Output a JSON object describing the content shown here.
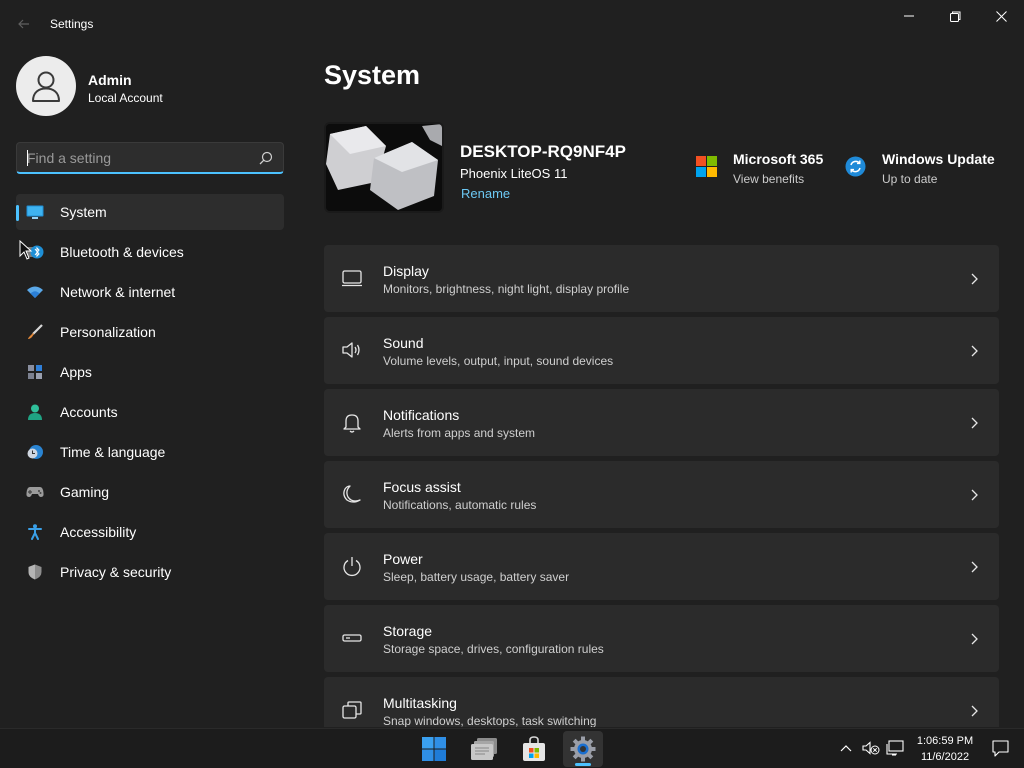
{
  "window": {
    "title": "Settings",
    "back_icon": "back-arrow-icon",
    "controls": [
      "minimize-icon",
      "restore-icon",
      "close-icon"
    ]
  },
  "profile": {
    "name": "Admin",
    "account_type": "Local Account"
  },
  "search": {
    "placeholder": "Find a setting",
    "value": ""
  },
  "sidebar": {
    "items": [
      {
        "label": "System",
        "icon": "system-monitor-icon",
        "active": true
      },
      {
        "label": "Bluetooth & devices",
        "icon": "bluetooth-icon"
      },
      {
        "label": "Network & internet",
        "icon": "wifi-icon"
      },
      {
        "label": "Personalization",
        "icon": "brush-icon"
      },
      {
        "label": "Apps",
        "icon": "apps-icon"
      },
      {
        "label": "Accounts",
        "icon": "person-icon"
      },
      {
        "label": "Time & language",
        "icon": "clock-globe-icon"
      },
      {
        "label": "Gaming",
        "icon": "gamepad-icon"
      },
      {
        "label": "Accessibility",
        "icon": "accessibility-icon"
      },
      {
        "label": "Privacy & security",
        "icon": "shield-icon"
      }
    ]
  },
  "main": {
    "title": "System",
    "device": {
      "name": "DESKTOP-RQ9NF4P",
      "os": "Phoenix LiteOS 11",
      "rename_label": "Rename"
    },
    "tiles": [
      {
        "title": "Microsoft 365",
        "subtitle": "View benefits",
        "icon": "microsoft-logo-icon"
      },
      {
        "title": "Windows Update",
        "subtitle": "Up to date",
        "icon": "update-sync-icon"
      }
    ],
    "cards": [
      {
        "title": "Display",
        "subtitle": "Monitors, brightness, night light, display profile",
        "icon": "display-icon"
      },
      {
        "title": "Sound",
        "subtitle": "Volume levels, output, input, sound devices",
        "icon": "speaker-icon"
      },
      {
        "title": "Notifications",
        "subtitle": "Alerts from apps and system",
        "icon": "bell-icon"
      },
      {
        "title": "Focus assist",
        "subtitle": "Notifications, automatic rules",
        "icon": "moon-icon"
      },
      {
        "title": "Power",
        "subtitle": "Sleep, battery usage, battery saver",
        "icon": "power-icon"
      },
      {
        "title": "Storage",
        "subtitle": "Storage space, drives, configuration rules",
        "icon": "storage-drive-icon"
      },
      {
        "title": "Multitasking",
        "subtitle": "Snap windows, desktops, task switching",
        "icon": "multitasking-icon"
      }
    ]
  },
  "taskbar": {
    "apps": [
      {
        "name": "start",
        "icon": "windows-start-icon"
      },
      {
        "name": "file-explorer",
        "icon": "file-explorer-icon"
      },
      {
        "name": "store",
        "icon": "store-bag-icon"
      },
      {
        "name": "settings",
        "icon": "settings-gear-icon",
        "active": true
      }
    ],
    "tray": [
      "chevron-up-icon",
      "speaker-muted-icon",
      "network-icon"
    ],
    "time": "1:06:59 PM",
    "date": "11/6/2022",
    "notification_icon": "notification-icon"
  },
  "colors": {
    "background": "#202020",
    "card": "#2b2b2b",
    "accent": "#4cc2ff",
    "link": "#6cc8f3"
  }
}
